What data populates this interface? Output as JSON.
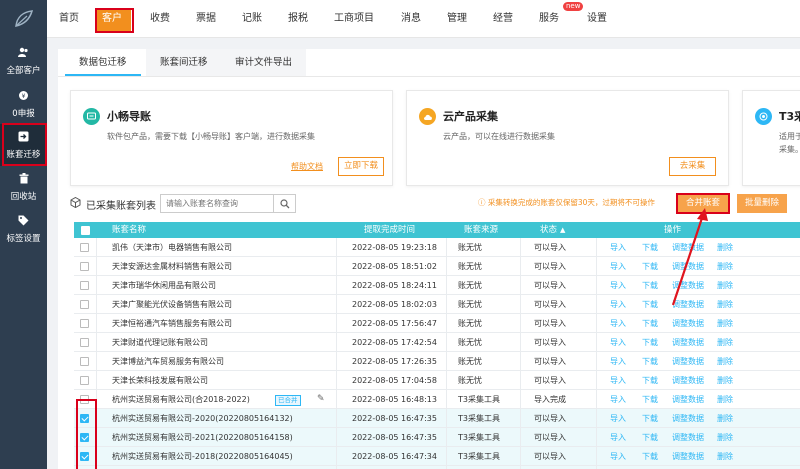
{
  "sidebar": {
    "items": [
      {
        "label": "全部客户",
        "icon": "user-icon"
      },
      {
        "label": "0申报",
        "icon": "coin-icon"
      },
      {
        "label": "账套迁移",
        "icon": "migrate-icon"
      },
      {
        "label": "回收站",
        "icon": "trash-icon"
      },
      {
        "label": "标签设置",
        "icon": "tag-icon"
      }
    ]
  },
  "topnav": {
    "items": [
      "首页",
      "客户",
      "收费",
      "票据",
      "记账",
      "报税",
      "工商项目",
      "消息",
      "管理",
      "经营",
      "服务",
      "设置"
    ],
    "new_badge": "new"
  },
  "tabs": [
    "数据包迁移",
    "账套间迁移",
    "审计文件导出"
  ],
  "cards": [
    {
      "title": "小畅导账",
      "desc": "软件包产品，需要下载【小畅导账】客户端，进行数据采集",
      "link": "帮助文档",
      "button": "立即下载"
    },
    {
      "title": "云产品采集",
      "desc": "云产品，可以在线进行数据采集",
      "button": "去采集"
    },
    {
      "title": "T3采",
      "desc": "适用于",
      "desc2": "采集。"
    }
  ],
  "list": {
    "title": "已采集账套列表",
    "search_placeholder": "请输入账套名称查询",
    "notice": "采集转换完成的账套仅保留30天，过期将不可操作",
    "merge_button": "合并账套",
    "batch_delete_button": "批量删除"
  },
  "table": {
    "headers": [
      "账套名称",
      "提取完成时间",
      "账套来源",
      "状态",
      "操作"
    ],
    "actions": [
      "导入",
      "下载",
      "调整数据",
      "删除"
    ],
    "tag_label": "已合并",
    "rows": [
      {
        "name": "凯伟（天津市）电器销售有限公司",
        "time": "2022-08-05 19:23:18",
        "source": "账无忧",
        "status": "可以导入",
        "checked": false
      },
      {
        "name": "天津安源达金属材料销售有限公司",
        "time": "2022-08-05 18:51:02",
        "source": "账无忧",
        "status": "可以导入",
        "checked": false
      },
      {
        "name": "天津市瑞华休闲用品有限公司",
        "time": "2022-08-05 18:24:11",
        "source": "账无忧",
        "status": "可以导入",
        "checked": false
      },
      {
        "name": "天津广聚能光伏设备销售有限公司",
        "time": "2022-08-05 18:02:03",
        "source": "账无忧",
        "status": "可以导入",
        "checked": false
      },
      {
        "name": "天津恒裕通汽车销售服务有限公司",
        "time": "2022-08-05 17:56:47",
        "source": "账无忧",
        "status": "可以导入",
        "checked": false
      },
      {
        "name": "天津财道代理记账有限公司",
        "time": "2022-08-05 17:42:54",
        "source": "账无忧",
        "status": "可以导入",
        "checked": false
      },
      {
        "name": "天津博益汽车贸易服务有限公司",
        "time": "2022-08-05 17:26:35",
        "source": "账无忧",
        "status": "可以导入",
        "checked": false
      },
      {
        "name": "天津长荣科技发展有限公司",
        "time": "2022-08-05 17:04:58",
        "source": "账无忧",
        "status": "可以导入",
        "checked": false
      },
      {
        "name": "杭州实送贸易有限公司(合2018-2022)",
        "time": "2022-08-05 16:48:13",
        "source": "T3采集工具",
        "status": "导入完成",
        "checked": false,
        "tagged": true
      },
      {
        "name": "杭州实送贸易有限公司-2020(20220805164132)",
        "time": "2022-08-05 16:47:35",
        "source": "T3采集工具",
        "status": "可以导入",
        "checked": true
      },
      {
        "name": "杭州实送贸易有限公司-2021(20220805164158)",
        "time": "2022-08-05 16:47:35",
        "source": "T3采集工具",
        "status": "可以导入",
        "checked": true
      },
      {
        "name": "杭州实送贸易有限公司-2018(20220805164045)",
        "time": "2022-08-05 16:47:34",
        "source": "T3采集工具",
        "status": "可以导入",
        "checked": true
      },
      {
        "name": "杭州实送贸易有限公司-2019(20220805164106)",
        "time": "2022-08-05 16:47:34",
        "source": "T3采集工具",
        "status": "可以导入",
        "checked": true
      }
    ]
  },
  "colors": {
    "accent": "#f28f1e",
    "teal_header": "#3fc4d2",
    "link": "#2db7f5",
    "highlight": "#d9001b",
    "sidebar": "#2e3e50"
  }
}
